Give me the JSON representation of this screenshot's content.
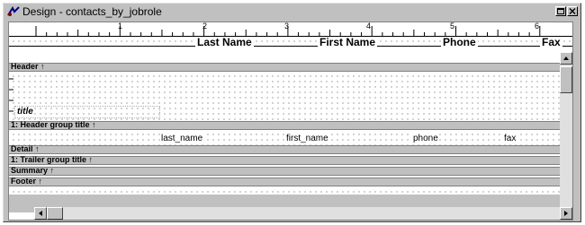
{
  "window": {
    "title": "Design - contacts_by_jobrole"
  },
  "ruler": {
    "numbers": [
      "1",
      "2",
      "3",
      "4",
      "5",
      "6"
    ]
  },
  "columns": {
    "last_name_header": "Last Name",
    "first_name_header": "First Name",
    "phone_header": "Phone",
    "fax_header": "Fax"
  },
  "bands": {
    "header": "Header ↑",
    "header_group": "1: Header group title ↑",
    "detail": "Detail ↑",
    "trailer_group": "1: Trailer group title ↑",
    "summary": "Summary ↑",
    "footer": "Footer ↑"
  },
  "header_band": {
    "title_field": "title"
  },
  "detail_fields": {
    "last_name": "last_name",
    "first_name": "first_name",
    "phone": "phone",
    "fax": "fax"
  }
}
